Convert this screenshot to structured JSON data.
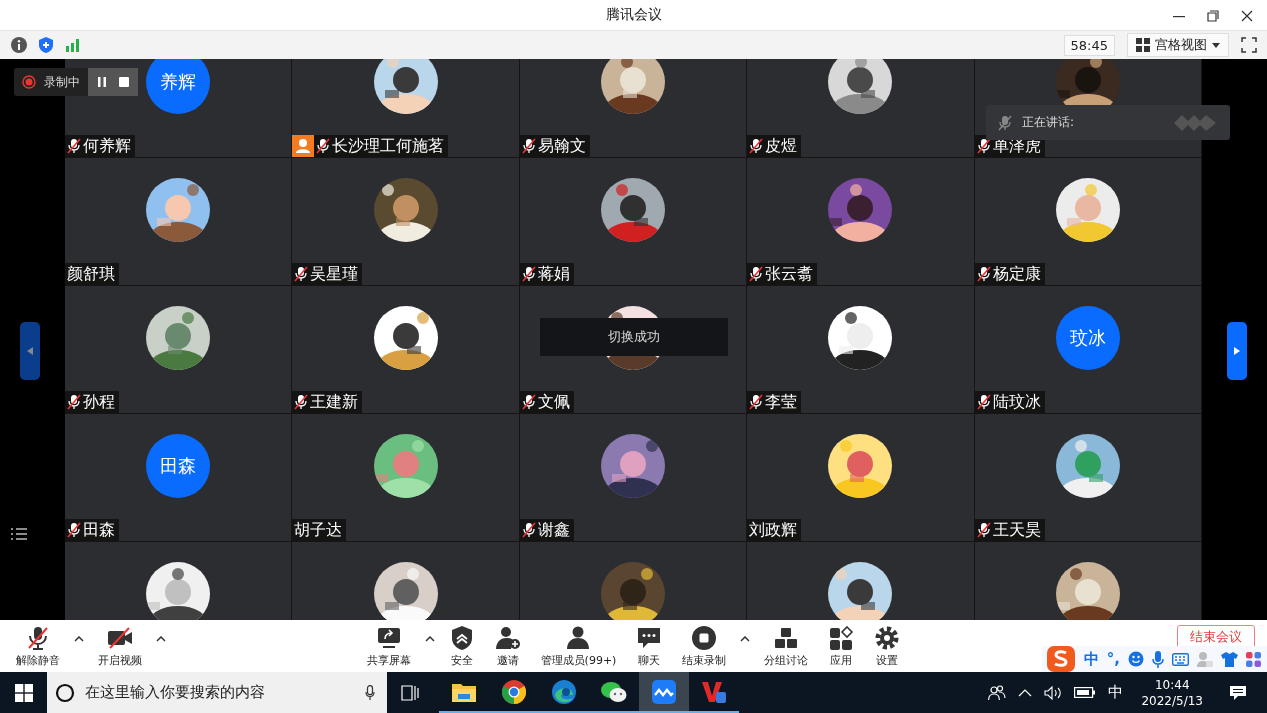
{
  "window": {
    "title": "腾讯会议"
  },
  "status_bar": {
    "timer": "58:45",
    "view_mode": "宫格视图"
  },
  "recording": {
    "label": "录制中"
  },
  "speaking": {
    "label": "正在讲话:"
  },
  "toast": "切换成功",
  "participants": [
    {
      "name": "何养辉",
      "muted": true,
      "host": false,
      "avatar": {
        "kind": "initials",
        "text": "养辉"
      }
    },
    {
      "name": "长沙理工何施茗",
      "muted": true,
      "host": true,
      "avatar": {
        "kind": "picture"
      }
    },
    {
      "name": "易翰文",
      "muted": true,
      "host": false,
      "avatar": {
        "kind": "picture"
      }
    },
    {
      "name": "皮煜",
      "muted": true,
      "host": false,
      "avatar": {
        "kind": "picture"
      }
    },
    {
      "name": "单泽虎",
      "muted": true,
      "host": false,
      "avatar": {
        "kind": "picture"
      }
    },
    {
      "name": "颜舒琪",
      "muted": false,
      "host": false,
      "avatar": {
        "kind": "picture"
      }
    },
    {
      "name": "吴星瑾",
      "muted": true,
      "host": false,
      "avatar": {
        "kind": "picture"
      }
    },
    {
      "name": "蒋娟",
      "muted": true,
      "host": false,
      "avatar": {
        "kind": "picture"
      }
    },
    {
      "name": "张云翥",
      "muted": true,
      "host": false,
      "avatar": {
        "kind": "picture"
      }
    },
    {
      "name": "杨定康",
      "muted": true,
      "host": false,
      "avatar": {
        "kind": "picture"
      }
    },
    {
      "name": "孙程",
      "muted": true,
      "host": false,
      "avatar": {
        "kind": "picture"
      }
    },
    {
      "name": "王建新",
      "muted": true,
      "host": false,
      "avatar": {
        "kind": "picture"
      }
    },
    {
      "name": "文佩",
      "muted": true,
      "host": false,
      "avatar": {
        "kind": "picture"
      }
    },
    {
      "name": "李莹",
      "muted": true,
      "host": false,
      "avatar": {
        "kind": "picture"
      }
    },
    {
      "name": "陆玟冰",
      "muted": true,
      "host": false,
      "avatar": {
        "kind": "initials",
        "text": "玟冰"
      }
    },
    {
      "name": "田森",
      "muted": true,
      "host": false,
      "avatar": {
        "kind": "initials",
        "text": "田森"
      }
    },
    {
      "name": "胡子达",
      "muted": false,
      "host": false,
      "avatar": {
        "kind": "picture"
      }
    },
    {
      "name": "谢鑫",
      "muted": true,
      "host": false,
      "avatar": {
        "kind": "picture"
      }
    },
    {
      "name": "刘政辉",
      "muted": false,
      "host": false,
      "avatar": {
        "kind": "picture"
      }
    },
    {
      "name": "王天昊",
      "muted": true,
      "host": false,
      "avatar": {
        "kind": "picture"
      }
    },
    {
      "avatar": {
        "kind": "picture"
      }
    },
    {
      "avatar": {
        "kind": "picture"
      }
    },
    {
      "avatar": {
        "kind": "picture"
      }
    },
    {
      "avatar": {
        "kind": "picture"
      }
    },
    {
      "avatar": {
        "kind": "picture"
      }
    }
  ],
  "toolbar": {
    "left": [
      {
        "kind": "mic-off",
        "label": "解除静音",
        "menu": true
      },
      {
        "kind": "video-off",
        "label": "开启视频",
        "menu": true
      }
    ],
    "center": [
      {
        "kind": "share",
        "label": "共享屏幕",
        "menu": true
      },
      {
        "kind": "security",
        "label": "安全",
        "menu": false
      },
      {
        "kind": "invite",
        "label": "邀请",
        "menu": false
      },
      {
        "kind": "members",
        "label": "管理成员(99+)",
        "menu": false
      },
      {
        "kind": "chat",
        "label": "聊天",
        "menu": false
      },
      {
        "kind": "record",
        "label": "结束录制",
        "menu": true
      },
      {
        "kind": "breakout",
        "label": "分组讨论",
        "menu": false
      },
      {
        "kind": "apps",
        "label": "应用",
        "menu": false
      },
      {
        "kind": "settings",
        "label": "设置",
        "menu": false
      }
    ],
    "end_button": "结束会议"
  },
  "ime": {
    "mode": "中",
    "punct": "°,"
  },
  "taskbar": {
    "search_placeholder": "在这里输入你要搜索的内容",
    "apps": [
      {
        "kind": "folder",
        "selected": false
      },
      {
        "kind": "chrome",
        "selected": false
      },
      {
        "kind": "edge",
        "selected": false
      },
      {
        "kind": "wechat",
        "selected": false
      },
      {
        "kind": "meeting",
        "selected": true
      },
      {
        "kind": "wps",
        "selected": false
      }
    ],
    "tray_lang": "中",
    "time": "10:44",
    "date": "2022/5/13"
  }
}
